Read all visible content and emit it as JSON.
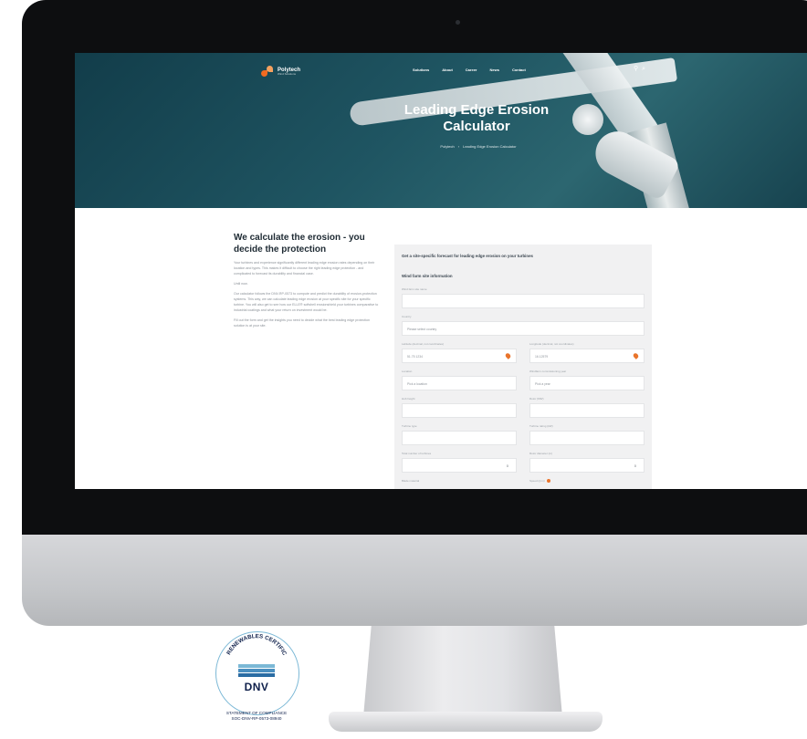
{
  "site": {
    "logo_name": "Polytech",
    "logo_tagline": "Wind Solutions",
    "nav": [
      "Solutions",
      "About",
      "Career",
      "News",
      "Contact"
    ],
    "hero_title": "Leading Edge Erosion Calculator",
    "breadcrumb": [
      "Polytech",
      "Leading Edge Erosion Calculator"
    ],
    "colors": {
      "accent": "#f26b21",
      "hero": "#1f5562",
      "heading": "#1e2a33"
    }
  },
  "intro": {
    "heading": "We calculate the erosion - you decide the protection",
    "paragraphs": [
      "Your turbines and experience significantly different leading edge erosion rates depending on their location and types. This makes it difficult to choose the right leading edge protection - and complicated to forecast its durability and financial case.",
      "Until now.",
      "Our calculator follows the DNV-RP-0573 to compute and predict the durability of erosion-protection systems. This way, we can calculate leading edge erosion at your specific site for your specific turbine. You will also get to see how our ELLE® softshell erosionshield your turbines comparative to industrial coatings and what your return on investment would be.",
      "Fill out the form and get the insights you need to decide what the best leading edge protection solution is at your site."
    ]
  },
  "form": {
    "title": "Get a site-specific forecast for leading edge erosion on your turbines",
    "section": "Wind farm site information",
    "fields": {
      "site_name": {
        "label": "Wind farm site name"
      },
      "country": {
        "label": "Country",
        "placeholder": "Please select country"
      },
      "latitude": {
        "label": "Latitude (decimal, not coordinates)",
        "placeholder": "51.75 1234"
      },
      "longitude": {
        "label": "Longitude (decimal, not coordinates)",
        "placeholder": "16.12579"
      },
      "location": {
        "label": "Location",
        "placeholder": "Pick a location"
      },
      "commissioning": {
        "label": "Windfarm commissioning year",
        "placeholder": "Pick a year"
      },
      "hub_height": {
        "label": "Hub height"
      },
      "rotor": {
        "label": "Rotor (MW)"
      },
      "turbine_type": {
        "label": "Turbine type"
      },
      "turbine_rating": {
        "label": "Turbine rating (kW)"
      },
      "turbines": {
        "label": "Total number of turbines",
        "placeholder": "0"
      },
      "rotor_diameter": {
        "label": "Rotor diameter (m)",
        "placeholder": "0"
      },
      "blade_material": {
        "label": "Blade material"
      },
      "speed": {
        "label": "Speed (rpm)"
      }
    }
  },
  "badge": {
    "certification": "RENEWABLES CERTIFICATION",
    "brand": "DNV",
    "statement": "STATEMENT OF COMPLIANCE",
    "code": "SOC-DNV-RP-0573-08940",
    "colors": [
      "#7bb8d6",
      "#4a8fbf",
      "#2b6ca3"
    ]
  }
}
